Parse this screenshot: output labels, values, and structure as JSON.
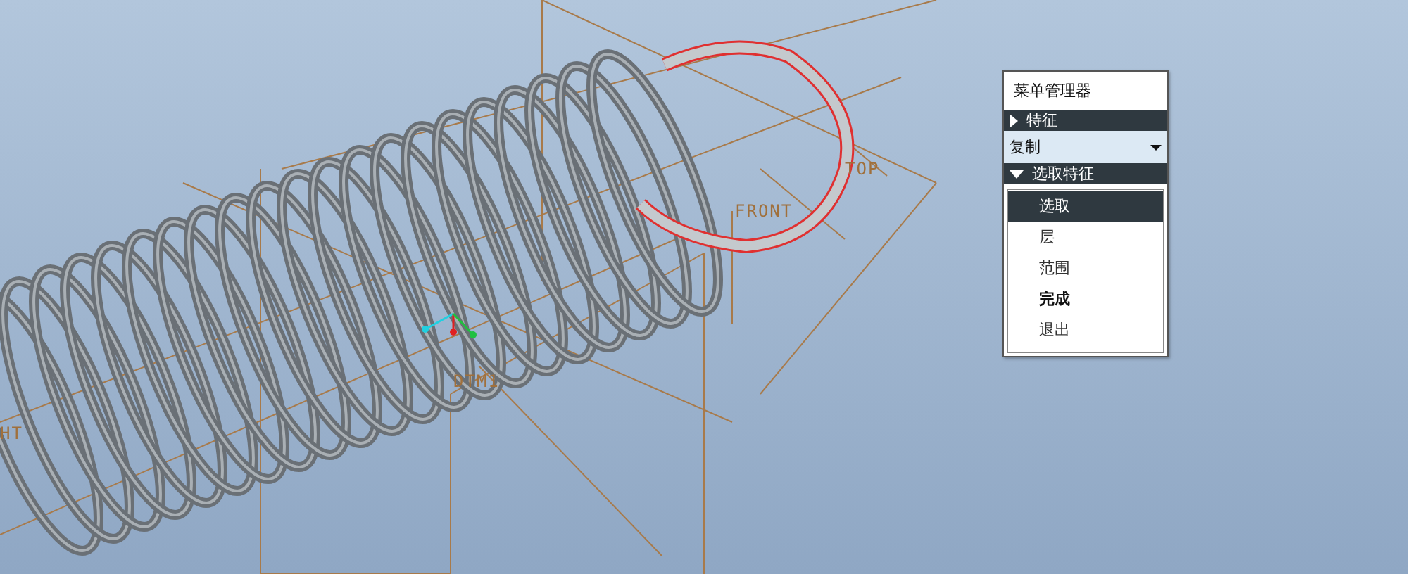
{
  "viewport": {
    "plane_labels": [
      {
        "text": "FRONT"
      },
      {
        "text": "TOP"
      },
      {
        "text": "DTM1"
      },
      {
        "text": "HT"
      }
    ]
  },
  "menu_manager": {
    "title": "菜单管理器",
    "sections": [
      {
        "kind": "header",
        "label": "特征",
        "expanded": false
      },
      {
        "kind": "dropdown",
        "value": "复制"
      },
      {
        "kind": "header",
        "label": "选取特征",
        "expanded": true
      },
      {
        "kind": "list",
        "items": [
          {
            "label": "选取",
            "selected": true,
            "emphasized": false
          },
          {
            "label": "层",
            "selected": false,
            "emphasized": false
          },
          {
            "label": "范围",
            "selected": false,
            "emphasized": false
          },
          {
            "label": "完成",
            "selected": false,
            "emphasized": true
          },
          {
            "label": "退出",
            "selected": false,
            "emphasized": false
          }
        ]
      }
    ]
  }
}
